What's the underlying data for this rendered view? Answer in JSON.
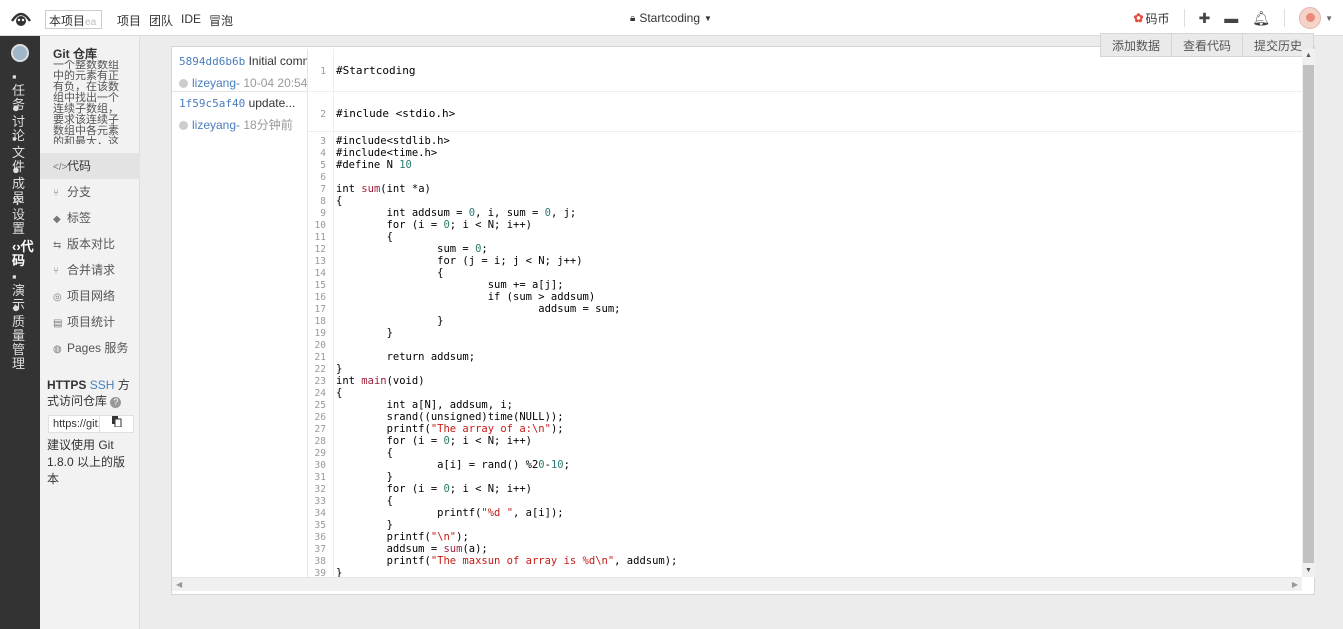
{
  "topbar": {
    "project_search": {
      "value": "本项目",
      "placeholder": "ea"
    },
    "nav": [
      "项目",
      "团队",
      "IDE",
      "冒泡"
    ],
    "repo_name": "Startcoding",
    "coin_label": "码币",
    "icons": [
      "plus-icon",
      "folder-icon",
      "bell-icon",
      "avatar"
    ]
  },
  "leftbar": {
    "items": [
      {
        "label": "任务",
        "icon": "task-icon"
      },
      {
        "label": "讨论",
        "icon": "discuss-icon"
      },
      {
        "label": "文件",
        "icon": "file-icon"
      },
      {
        "label": "成员",
        "icon": "member-icon"
      },
      {
        "label": "设置",
        "icon": "settings-icon"
      },
      {
        "label": "代码",
        "icon": "code-icon",
        "active": true
      },
      {
        "label": "演示",
        "icon": "demo-icon"
      },
      {
        "label": "质量管理",
        "icon": "quality-icon"
      }
    ]
  },
  "sidebar": {
    "title": "Git 仓库",
    "description": "一个整数数组中的元素有正有负，在该数组中找出一个连续子数组，要求该连续子数组中各元素的和最大，这个连续子数组便被称作最大连续子数组。",
    "menu": [
      {
        "label": "代码",
        "icon": "</>",
        "active": true
      },
      {
        "label": "分支",
        "icon": "⑂"
      },
      {
        "label": "标签",
        "icon": "◆"
      },
      {
        "label": "版本对比",
        "icon": "⇆"
      },
      {
        "label": "合并请求",
        "icon": "⑂"
      },
      {
        "label": "项目网络",
        "icon": "◎"
      },
      {
        "label": "项目统计",
        "icon": "▤"
      },
      {
        "label": "Pages 服务",
        "icon": "◍"
      }
    ],
    "access": {
      "https": "HTTPS",
      "ssh": "SSH",
      "suffix": "方式访问仓库",
      "url": "https://git.coding.net",
      "copy_icon": "copy-icon",
      "hint": "建议使用 Git 1.8.0 以上的版本"
    }
  },
  "toolbar": {
    "buttons": [
      "添加数据",
      "查看代码",
      "提交历史"
    ]
  },
  "commits": [
    {
      "sha": "5894dd6b6b",
      "message": "Initial commit",
      "author": "lizeyang-",
      "time": "10-04 20:54"
    },
    {
      "sha": "1f59c5af40",
      "message": "update...",
      "author": "lizeyang-",
      "time": "18分钟前"
    }
  ],
  "code": {
    "block1": [
      {
        "n": "1",
        "t": "#Startcoding"
      }
    ],
    "block2": [
      {
        "n": "2",
        "t": "#include <stdio.h>"
      }
    ],
    "block3": [
      {
        "n": "3",
        "t": "#include<stdlib.h>"
      },
      {
        "n": "4",
        "t": "#include<time.h>"
      },
      {
        "n": "5",
        "t": "#define N 10"
      },
      {
        "n": "6",
        "t": ""
      },
      {
        "n": "7",
        "t": "int sum(int *a)"
      },
      {
        "n": "8",
        "t": "{"
      },
      {
        "n": "9",
        "t": "        int addsum = 0, i, sum = 0, j;"
      },
      {
        "n": "10",
        "t": "        for (i = 0; i < N; i++)"
      },
      {
        "n": "11",
        "t": "        {"
      },
      {
        "n": "12",
        "t": "                sum = 0;"
      },
      {
        "n": "13",
        "t": "                for (j = i; j < N; j++)"
      },
      {
        "n": "14",
        "t": "                {"
      },
      {
        "n": "15",
        "t": "                        sum += a[j];"
      },
      {
        "n": "16",
        "t": "                        if (sum > addsum)"
      },
      {
        "n": "17",
        "t": "                                addsum = sum;"
      },
      {
        "n": "18",
        "t": "                }"
      },
      {
        "n": "19",
        "t": "        }"
      },
      {
        "n": "20",
        "t": ""
      },
      {
        "n": "21",
        "t": "        return addsum;"
      },
      {
        "n": "22",
        "t": "}"
      },
      {
        "n": "23",
        "t": "int main(void)"
      },
      {
        "n": "24",
        "t": "{"
      },
      {
        "n": "25",
        "t": "        int a[N], addsum, i;"
      },
      {
        "n": "26",
        "t": "        srand((unsigned)time(NULL));"
      },
      {
        "n": "27",
        "t": "        printf(\"The array of a:\\n\");"
      },
      {
        "n": "28",
        "t": "        for (i = 0; i < N; i++)"
      },
      {
        "n": "29",
        "t": "        {"
      },
      {
        "n": "30",
        "t": "                a[i] = rand() %20-10;"
      },
      {
        "n": "31",
        "t": "        }"
      },
      {
        "n": "32",
        "t": "        for (i = 0; i < N; i++)"
      },
      {
        "n": "33",
        "t": "        {"
      },
      {
        "n": "34",
        "t": "                printf(\"%d \", a[i]);"
      },
      {
        "n": "35",
        "t": "        }"
      },
      {
        "n": "36",
        "t": "        printf(\"\\n\");"
      },
      {
        "n": "37",
        "t": "        addsum = sum(a);"
      },
      {
        "n": "38",
        "t": "        printf(\"The maxsun of array is %d\\n\", addsum);"
      },
      {
        "n": "39",
        "t": "}"
      }
    ]
  },
  "colors": {
    "accent": "#4a7dbe",
    "string": "#c41a16",
    "number": "#2c7a6f",
    "function": "#a0213a",
    "leftbar_bg": "#333333"
  }
}
